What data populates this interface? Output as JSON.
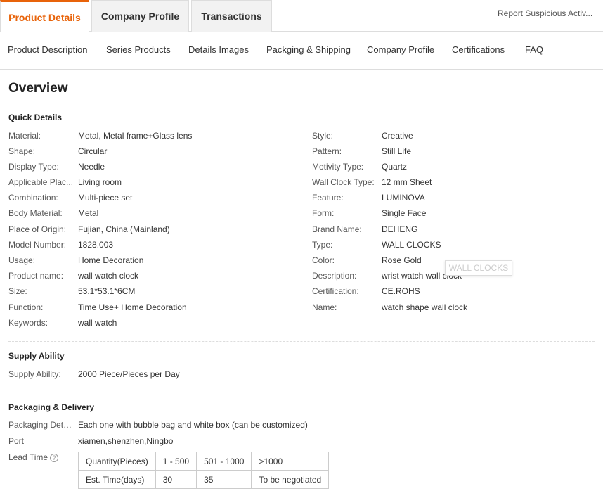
{
  "tabs": [
    {
      "label": "Product Details",
      "active": true
    },
    {
      "label": "Company Profile",
      "active": false
    },
    {
      "label": "Transactions",
      "active": false
    }
  ],
  "report_link": "Report Suspicious Activ...",
  "subnav": [
    "Product Description",
    "Series Products",
    "Details Images",
    "Packging & Shipping",
    "Company Profile",
    "Certifications",
    "FAQ"
  ],
  "overview_title": "Overview",
  "quick_details": {
    "title": "Quick Details",
    "left": [
      {
        "k": "Material:",
        "v": "Metal, Metal frame+Glass lens"
      },
      {
        "k": "Shape:",
        "v": "Circular"
      },
      {
        "k": "Display Type:",
        "v": "Needle"
      },
      {
        "k": "Applicable Plac...",
        "v": "Living room"
      },
      {
        "k": "Combination:",
        "v": "Multi-piece set"
      },
      {
        "k": "Body Material:",
        "v": "Metal"
      },
      {
        "k": "Place of Origin:",
        "v": "Fujian, China (Mainland)"
      },
      {
        "k": "Model Number:",
        "v": "1828.003"
      },
      {
        "k": "Usage:",
        "v": "Home Decoration"
      },
      {
        "k": "Product name:",
        "v": "wall watch clock"
      },
      {
        "k": "Size:",
        "v": "53.1*53.1*6CM"
      },
      {
        "k": "Function:",
        "v": "Time Use+ Home Decoration"
      },
      {
        "k": "Keywords:",
        "v": "wall watch"
      }
    ],
    "right": [
      {
        "k": "Style:",
        "v": "Creative"
      },
      {
        "k": "Pattern:",
        "v": "Still Life"
      },
      {
        "k": "Motivity Type:",
        "v": "Quartz"
      },
      {
        "k": "Wall Clock Type:",
        "v": "12 mm Sheet"
      },
      {
        "k": "Feature:",
        "v": "LUMINOVA"
      },
      {
        "k": "Form:",
        "v": "Single Face"
      },
      {
        "k": "Brand Name:",
        "v": "DEHENG"
      },
      {
        "k": "Type:",
        "v": "WALL CLOCKS"
      },
      {
        "k": "Color:",
        "v": "Rose Gold"
      },
      {
        "k": "Description:",
        "v": "wrist watch wall clock"
      },
      {
        "k": "Certification:",
        "v": "CE.ROHS"
      },
      {
        "k": "Name:",
        "v": "watch shape wall clock"
      }
    ]
  },
  "tooltip": "WALL CLOCKS",
  "supply": {
    "title": "Supply Ability",
    "k": "Supply Ability:",
    "v": "2000 Piece/Pieces per Day"
  },
  "packaging": {
    "title": "Packaging & Delivery",
    "details_k": "Packaging Details",
    "details_v": "Each one with bubble bag and white box (can be customized)",
    "port_k": "Port",
    "port_v": "xiamen,shenzhen,Ningbo",
    "lead_k": "Lead Time",
    "help_icon": "?",
    "lead_rows": [
      [
        "Quantity(Pieces)",
        "1 - 500",
        "501 - 1000",
        ">1000"
      ],
      [
        "Est. Time(days)",
        "30",
        "35",
        "To be negotiated"
      ]
    ]
  },
  "colors": {
    "accent": "#e8630a",
    "border": "#dddddd"
  }
}
